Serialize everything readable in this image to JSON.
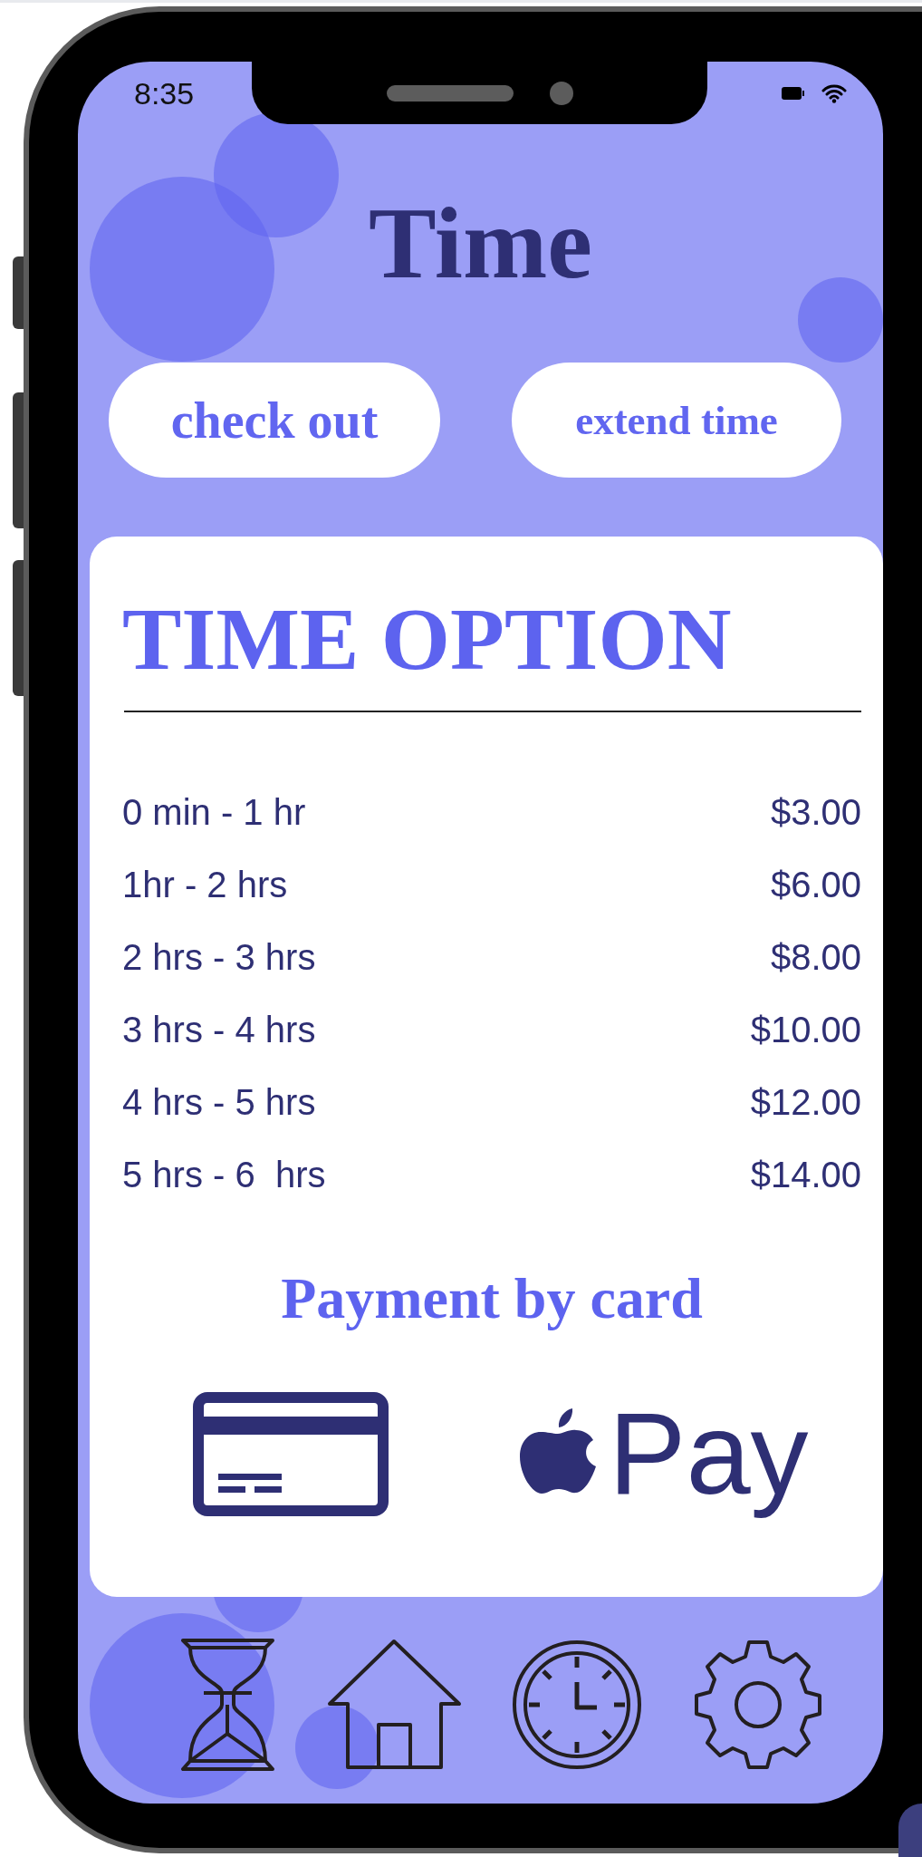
{
  "status_bar": {
    "time": "8:35"
  },
  "title": "Time",
  "buttons": [
    {
      "label": "check out"
    },
    {
      "label": "extend time"
    }
  ],
  "time_options": {
    "title": "TIME OPTION",
    "rows": [
      {
        "duration": "0 min - 1 hr",
        "price": "$3.00"
      },
      {
        "duration": "1hr - 2 hrs",
        "price": "$6.00"
      },
      {
        "duration": "2 hrs - 3 hrs",
        "price": "$8.00"
      },
      {
        "duration": "3 hrs - 4 hrs",
        "price": "$10.00"
      },
      {
        "duration": "4 hrs - 5 hrs",
        "price": "$12.00"
      },
      {
        "duration": "5 hrs - 6  hrs",
        "price": "$14.00"
      }
    ]
  },
  "payment": {
    "title": "Payment by card",
    "methods": [
      {
        "kind": "card"
      },
      {
        "kind": "apple_pay",
        "label": "Pay"
      }
    ]
  },
  "nav": [
    {
      "kind": "hourglass"
    },
    {
      "kind": "home"
    },
    {
      "kind": "clock"
    },
    {
      "kind": "settings"
    }
  ]
}
